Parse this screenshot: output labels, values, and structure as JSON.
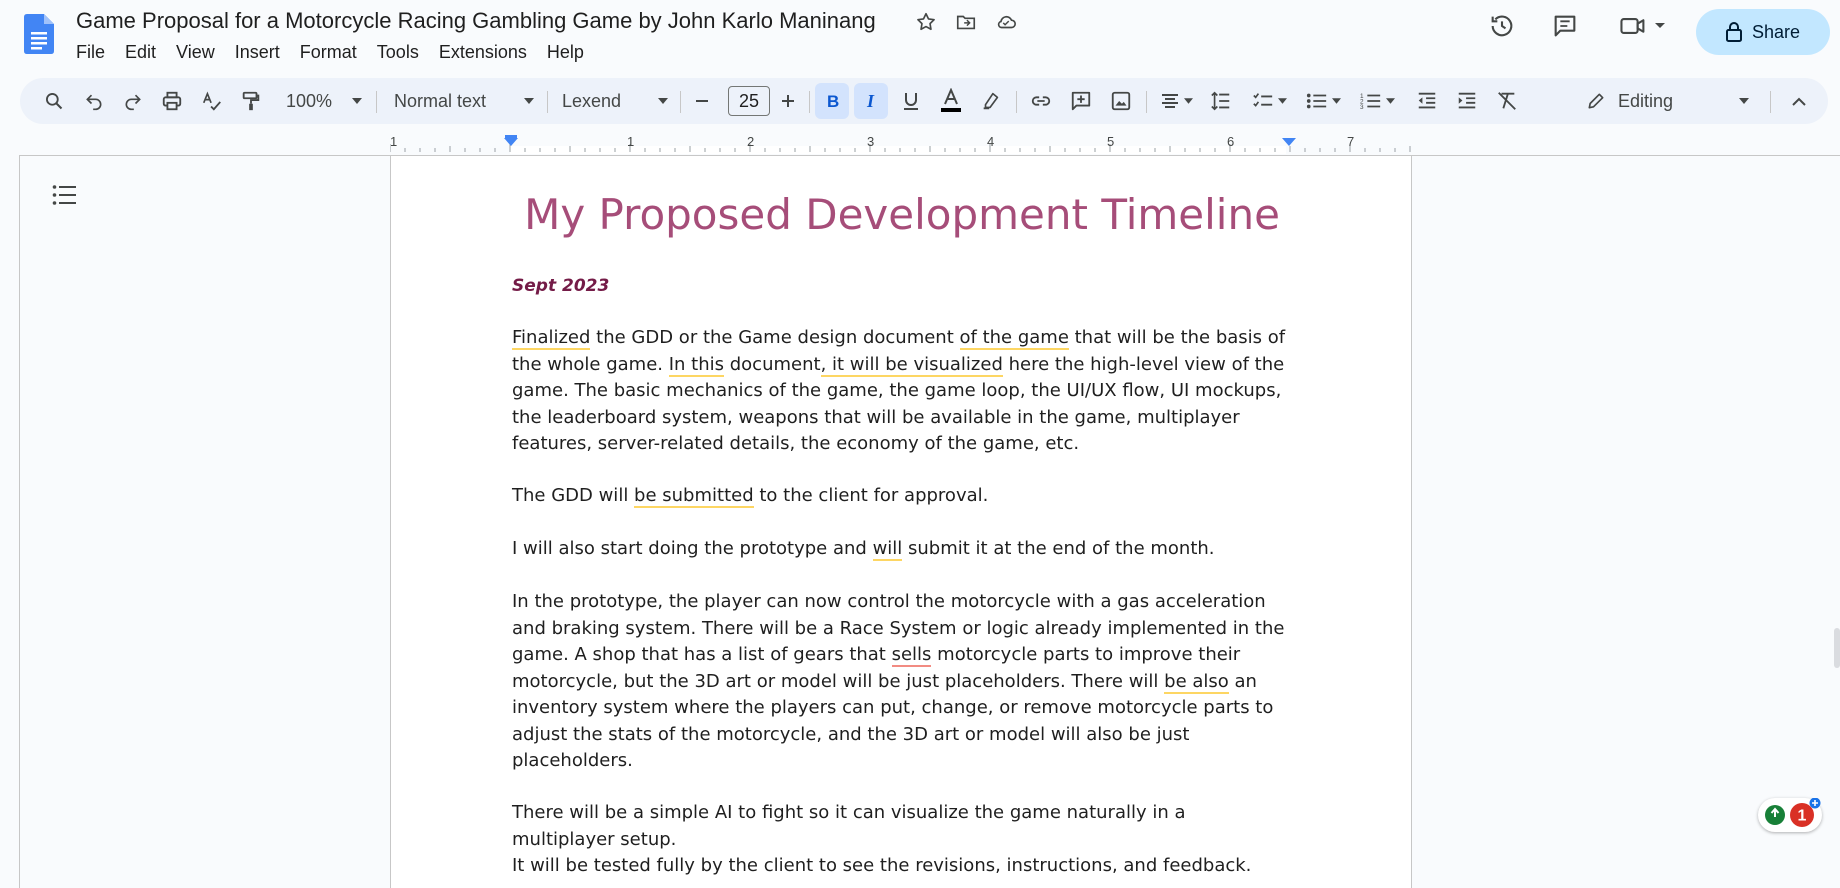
{
  "header": {
    "title": "Game Proposal for a Motorcycle Racing Gambling Game by John Karlo Maninang",
    "menus": [
      "File",
      "Edit",
      "View",
      "Insert",
      "Format",
      "Tools",
      "Extensions",
      "Help"
    ],
    "share_label": "Share"
  },
  "toolbar": {
    "zoom": "100%",
    "style": "Normal text",
    "font": "Lexend",
    "font_size": "25",
    "mode": "Editing"
  },
  "ruler": {
    "marks": [
      "1",
      "1",
      "2",
      "3",
      "4",
      "5",
      "6",
      "7"
    ]
  },
  "document": {
    "heading": "My Proposed Development Timeline",
    "date": "Sept 2023",
    "p1": {
      "a": "Finalized",
      "b": " the GDD or the Game design document ",
      "c": "of the game",
      "d": " that will be the basis of the whole game. ",
      "e": "In this",
      "f": " document",
      "g": ", it will be visualized",
      "h": " here the high-level view of the game. The basic mechanics of the game, the game loop, the UI/UX flow, UI mockups, the leaderboard system, weapons that will be available in the game, multiplayer features, server-related details, the economy of the game, etc."
    },
    "p2": {
      "a": "The GDD will ",
      "b": "be submitted",
      "c": " to the client for approval."
    },
    "p3": {
      "a": "I will also start doing the prototype and ",
      "b": "will",
      "c": " submit it at the end of the month."
    },
    "p4": {
      "a": "In the prototype, the player can now control the motorcycle with a gas acceleration and braking system. There will be a Race System or logic already implemented in the game. A shop that has a list of gears that ",
      "b": "sells",
      "c": " motorcycle parts to improve their motorcycle, but the 3D art or model will be just placeholders. There will ",
      "d": "be also",
      "e": " an inventory system where the players can put, change, or remove motorcycle parts to adjust the stats of the motorcycle, and the 3D art or model will also be just placeholders."
    },
    "p5": "There will be a simple AI to fight so it can visualize the game naturally in a multiplayer setup.",
    "p6": "It will be tested fully by the client to see the revisions, instructions, and feedback."
  },
  "badge": {
    "count": "1"
  },
  "colors": {
    "accent": "#c2e7ff",
    "heading": "#a64d79",
    "date": "#741b47",
    "toolbar_bg": "#edf2fa"
  }
}
